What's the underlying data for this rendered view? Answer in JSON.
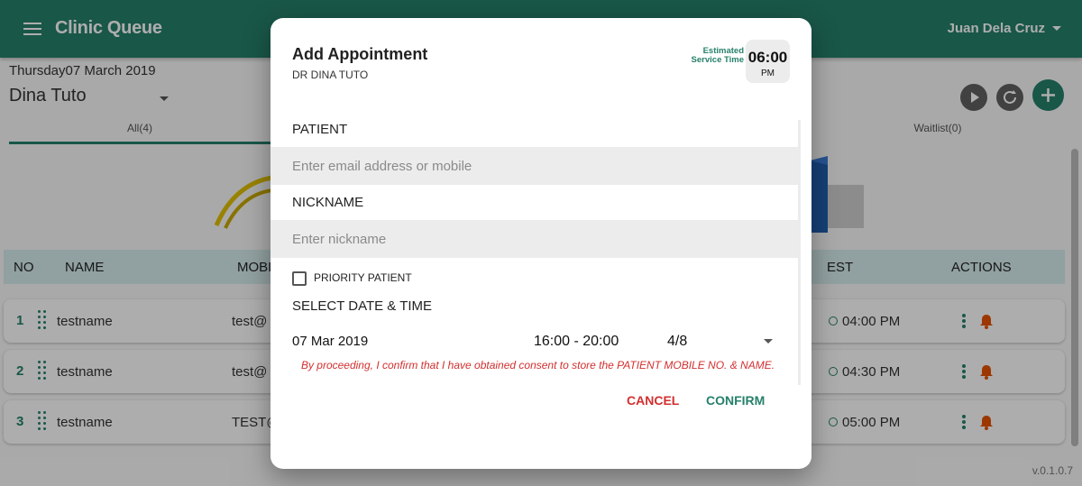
{
  "app": {
    "title": "Clinic Queue",
    "user_name": "Juan Dela Cruz",
    "date": "Thursday07 March 2019",
    "doctor": "Dina Tuto",
    "version": "v.0.1.0.7"
  },
  "tabs": [
    {
      "label": "All(4)",
      "active": true
    },
    {
      "label": "Waitlist(0)",
      "active": false
    }
  ],
  "table": {
    "headers": [
      "NO",
      "NAME",
      "MOBI",
      "EST",
      "ACTIONS"
    ],
    "rows": [
      {
        "no": "1",
        "name": "testname",
        "mobile": "test@",
        "est": "04:00 PM"
      },
      {
        "no": "2",
        "name": "testname",
        "mobile": "test@",
        "est": "04:30 PM"
      },
      {
        "no": "3",
        "name": "testname",
        "mobile": "TEST@",
        "est": "05:00 PM"
      }
    ]
  },
  "dialog": {
    "title": "Add Appointment",
    "subtitle": "DR DINA TUTO",
    "estimated_label": "Estimated Service Time",
    "estimated_time": "06:00",
    "estimated_ampm": "PM",
    "patient_label": "PATIENT",
    "patient_placeholder": "Enter email address or mobile",
    "nickname_label": "NICKNAME",
    "nickname_placeholder": "Enter nickname",
    "priority_label": "PRIORITY PATIENT",
    "priority_checked": false,
    "datetime_label": "SELECT DATE & TIME",
    "date": "07 Mar 2019",
    "time_range": "16:00 - 20:00",
    "slots": "4/8",
    "consent": "By proceeding, I confirm that I have obtained consent to store the PATIENT MOBILE NO. & NAME.",
    "cancel_label": "CANCEL",
    "confirm_label": "CONFIRM"
  },
  "colors": {
    "primary": "#26806b",
    "danger": "#d32f2f",
    "header_row": "#d6ecec",
    "bell": "#e65100"
  },
  "icons": [
    "menu-icon",
    "chevron-down-icon",
    "play-icon",
    "refresh-icon",
    "plus-icon",
    "drag-handle-icon",
    "clock-icon",
    "more-vertical-icon",
    "bell-icon"
  ]
}
